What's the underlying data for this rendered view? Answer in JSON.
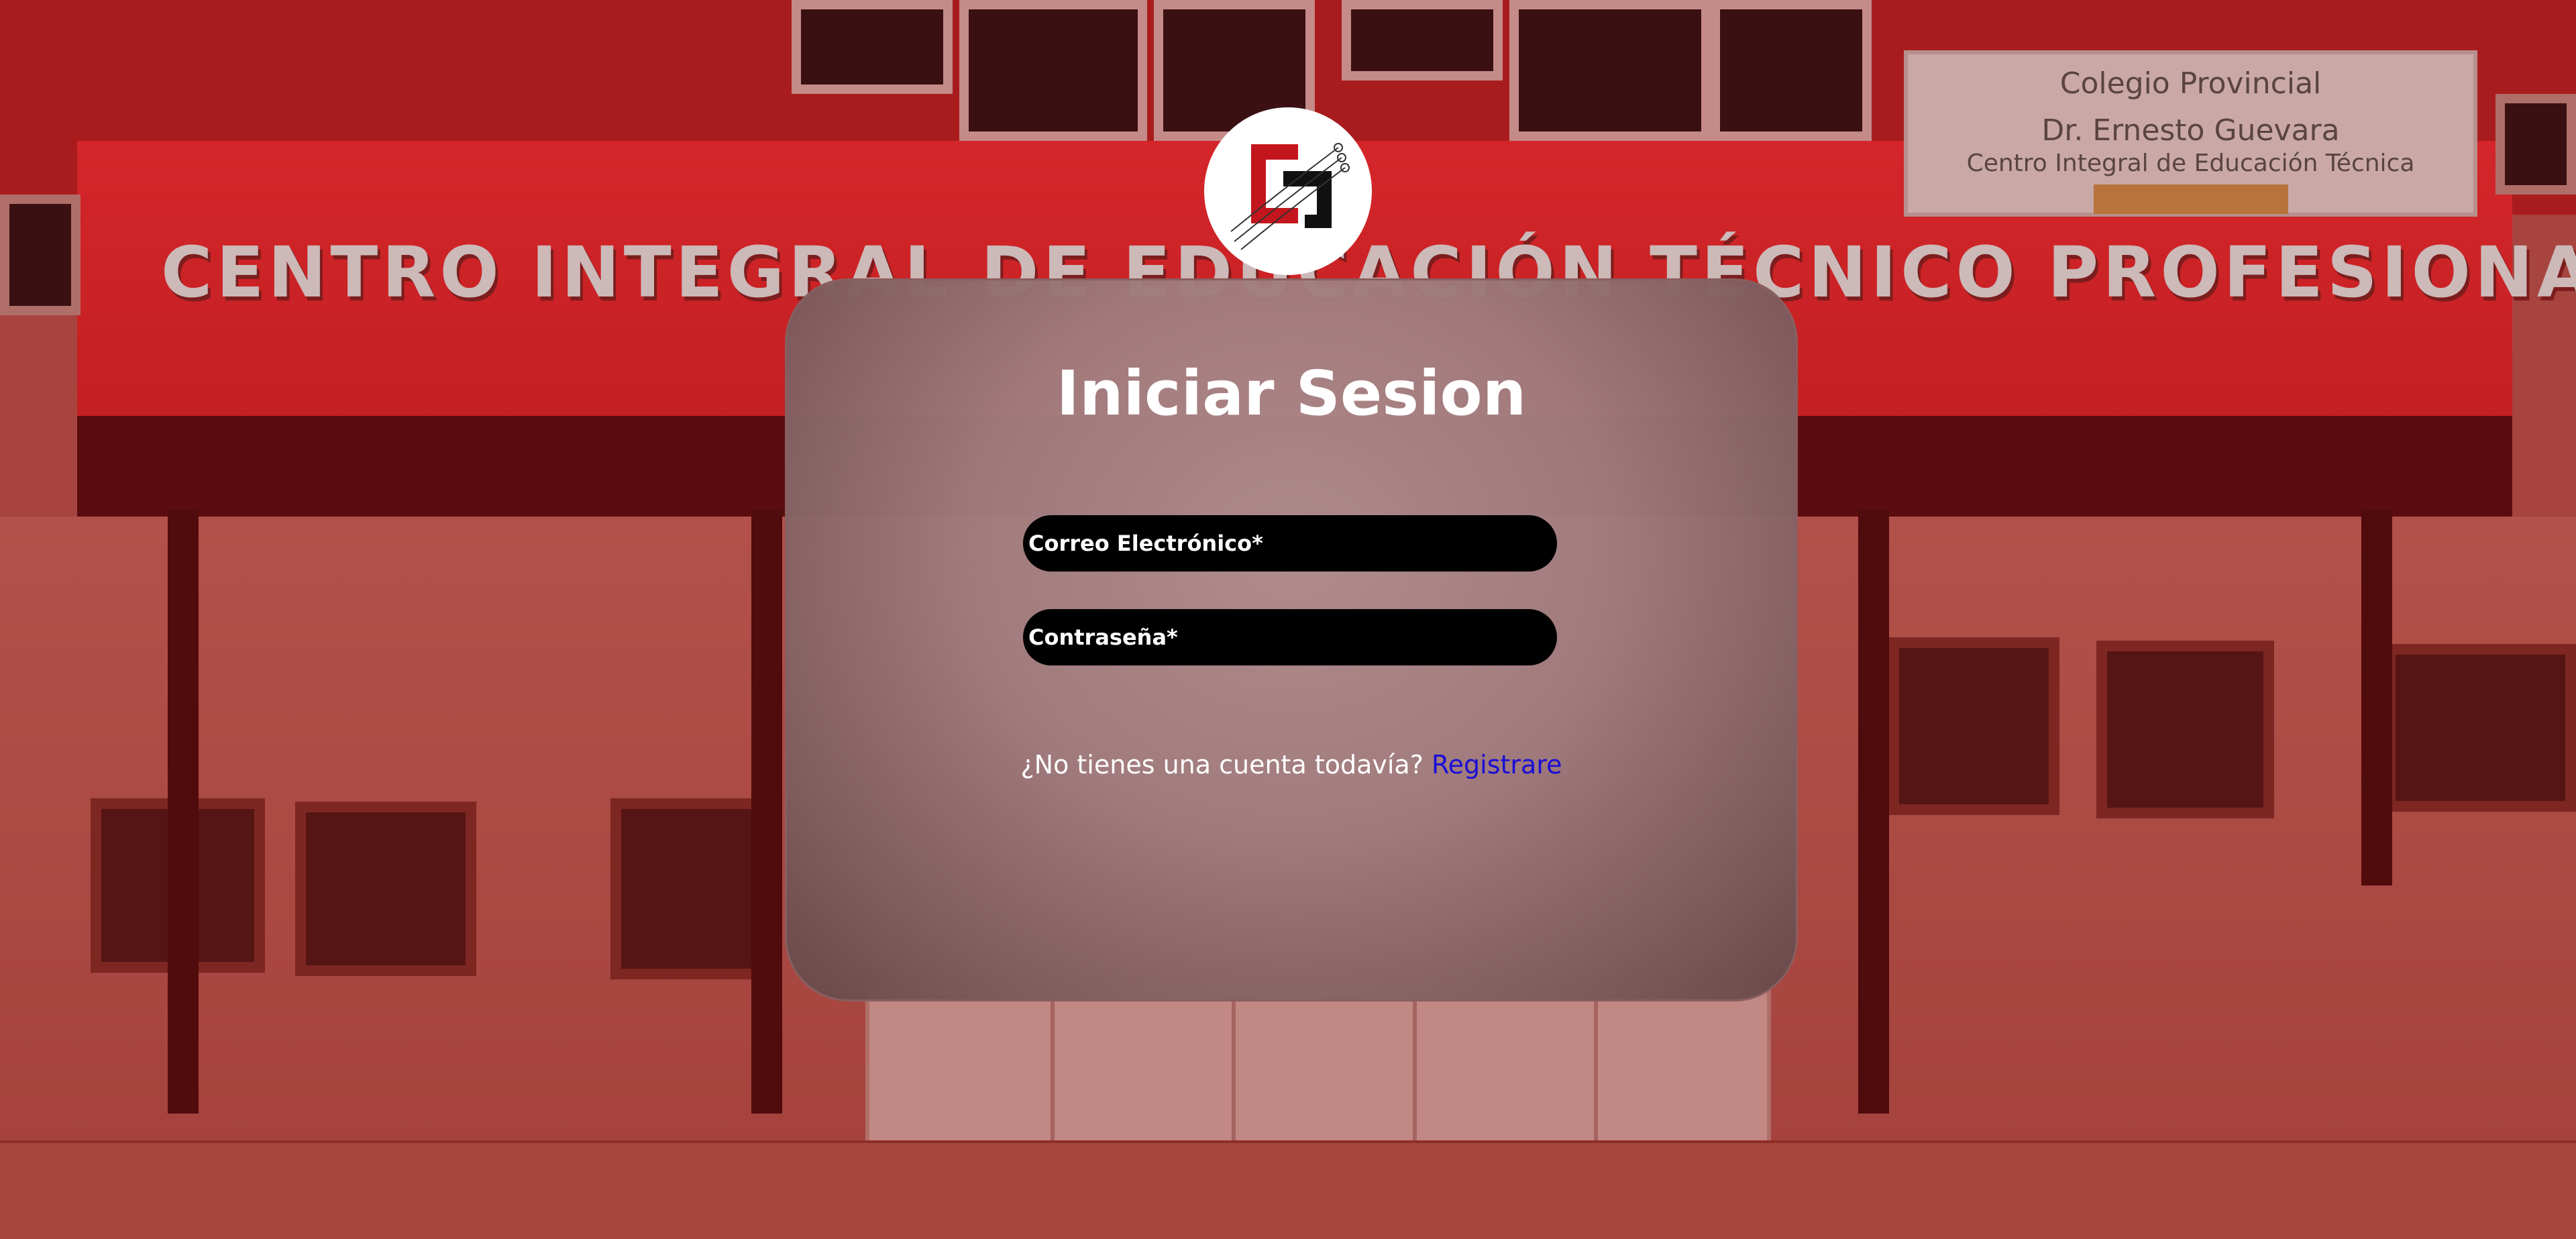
{
  "login": {
    "title": "Iniciar Sesion",
    "email_placeholder": "Correo Electrónico*",
    "password_placeholder": "Contraseña*",
    "register_prompt": "¿No tienes una cuenta todavía?",
    "register_link": "Registrare"
  },
  "background": {
    "facade_sign": "CENTRO INTEGRAL DE EDUCACIÓN TÉCNICO PROFESIONAL",
    "plaque_line1": "Colegio Provincial",
    "plaque_line2": "Dr. Ernesto Guevara",
    "plaque_line3": "Centro Integral de Educación Técnica"
  },
  "colors": {
    "overlay_red": "#c21f22",
    "field_bg": "#000000",
    "link": "#1a0dd6",
    "text": "#ffffff"
  },
  "icons": {
    "logo": "school-logo-cg"
  }
}
